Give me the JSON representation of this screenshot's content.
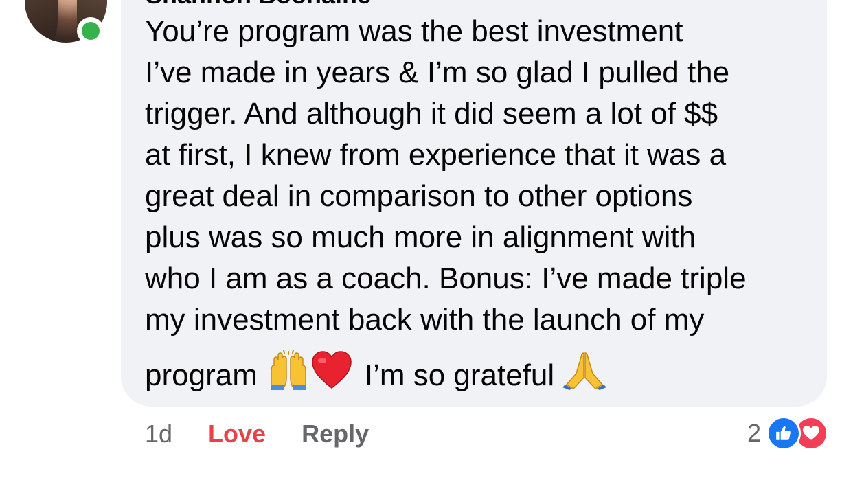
{
  "comment": {
    "author": "Shannon Boonaine",
    "lines": [
      "You’re program was the best investment",
      "I’ve made in years & I’m so glad I pulled the",
      "trigger. And although it did seem a lot of $$",
      "at first, I knew from experience that it was a",
      "great deal in comparison to other options",
      "plus was so much more in alignment with",
      "who I am as a coach. Bonus: I’ve made triple",
      "my investment back with the launch of my"
    ],
    "last_line_start": "program",
    "last_line_middle": "I’m so grateful",
    "emojis": {
      "raised_hands": "raising-hands-icon",
      "heart": "red-heart-icon",
      "praying": "folded-hands-icon"
    }
  },
  "actions": {
    "time": "1d",
    "love_label": "Love",
    "reply_label": "Reply"
  },
  "reactions": {
    "count": "2",
    "types": [
      "like-icon",
      "love-icon"
    ],
    "colors": {
      "like": "#1877f2",
      "love": "#f33e58",
      "love_text": "#e4434b",
      "presence": "#35b24b"
    }
  }
}
